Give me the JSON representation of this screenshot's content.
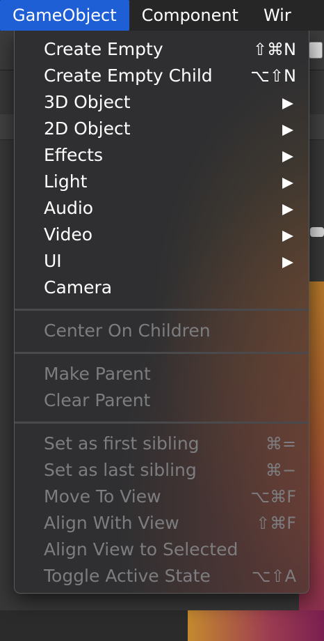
{
  "menubar": {
    "items": [
      {
        "label": "GameObject",
        "active": true
      },
      {
        "label": "Component",
        "active": false
      },
      {
        "label": "Wir",
        "active": false
      }
    ]
  },
  "menu": {
    "group1": [
      {
        "label": "Create Empty",
        "shortcut": "⇧⌘N"
      },
      {
        "label": "Create Empty Child",
        "shortcut": "⌥⇧N"
      },
      {
        "label": "3D Object",
        "submenu": true
      },
      {
        "label": "2D Object",
        "submenu": true
      },
      {
        "label": "Effects",
        "submenu": true
      },
      {
        "label": "Light",
        "submenu": true
      },
      {
        "label": "Audio",
        "submenu": true
      },
      {
        "label": "Video",
        "submenu": true
      },
      {
        "label": "UI",
        "submenu": true
      },
      {
        "label": "Camera"
      }
    ],
    "group2": [
      {
        "label": "Center On Children",
        "disabled": true
      }
    ],
    "group3": [
      {
        "label": "Make Parent",
        "disabled": true
      },
      {
        "label": "Clear Parent",
        "disabled": true
      }
    ],
    "group4": [
      {
        "label": "Set as first sibling",
        "shortcut": "⌘=",
        "disabled": true
      },
      {
        "label": "Set as last sibling",
        "shortcut": "⌘−",
        "disabled": true
      },
      {
        "label": "Move To View",
        "shortcut": "⌥⌘F",
        "disabled": true
      },
      {
        "label": "Align With View",
        "shortcut": "⇧⌘F",
        "disabled": true
      },
      {
        "label": "Align View to Selected",
        "disabled": true
      },
      {
        "label": "Toggle Active State",
        "shortcut": "⌥⇧A",
        "disabled": true
      }
    ]
  },
  "colors": {
    "menubar_bg": "#262626",
    "menubar_active": "#1e5fd6",
    "menu_bg": "#2f2f31",
    "text_enabled": "#ffffff",
    "text_disabled": "#7d7d80"
  }
}
